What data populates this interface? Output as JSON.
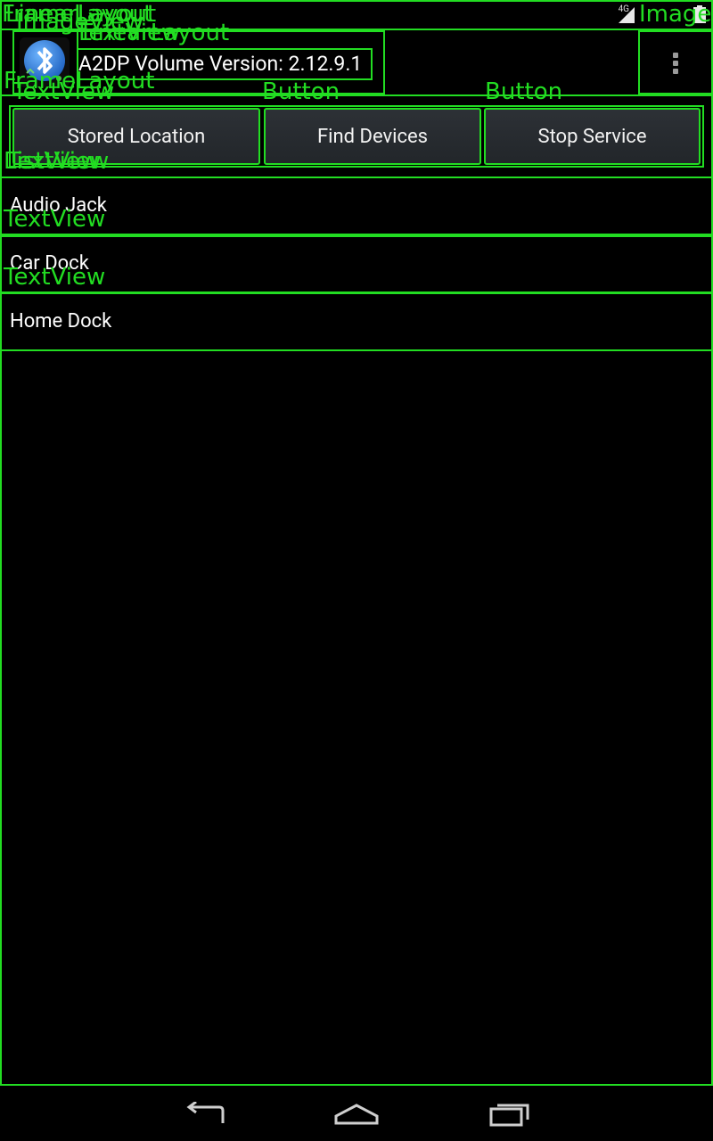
{
  "statusbar": {
    "network": "4G"
  },
  "actionbar": {
    "title": "A2DP Volume Version: 2.12.9.1",
    "logo_icon": "bluetooth-icon",
    "overflow_icon": "overflow-menu-icon"
  },
  "buttons": [
    {
      "label": "Stored Location"
    },
    {
      "label": "Find Devices"
    },
    {
      "label": "Stop Service"
    }
  ],
  "list": [
    {
      "label": "Audio Jack"
    },
    {
      "label": "Car Dock"
    },
    {
      "label": "Home Dock"
    }
  ],
  "overlay_labels": {
    "framelayout": "FrameLayout",
    "imageview": "ImageView",
    "linearlayout": "LinearLayout",
    "textview": "TextView",
    "image": "Image",
    "button": "Button",
    "listview": "ListView"
  },
  "navbar": {
    "back_icon": "back-icon",
    "home_icon": "home-icon",
    "recents_icon": "recents-icon"
  },
  "colors": {
    "overlay": "#22dd22",
    "background": "#000000",
    "button_bg": "#2a2e32"
  }
}
